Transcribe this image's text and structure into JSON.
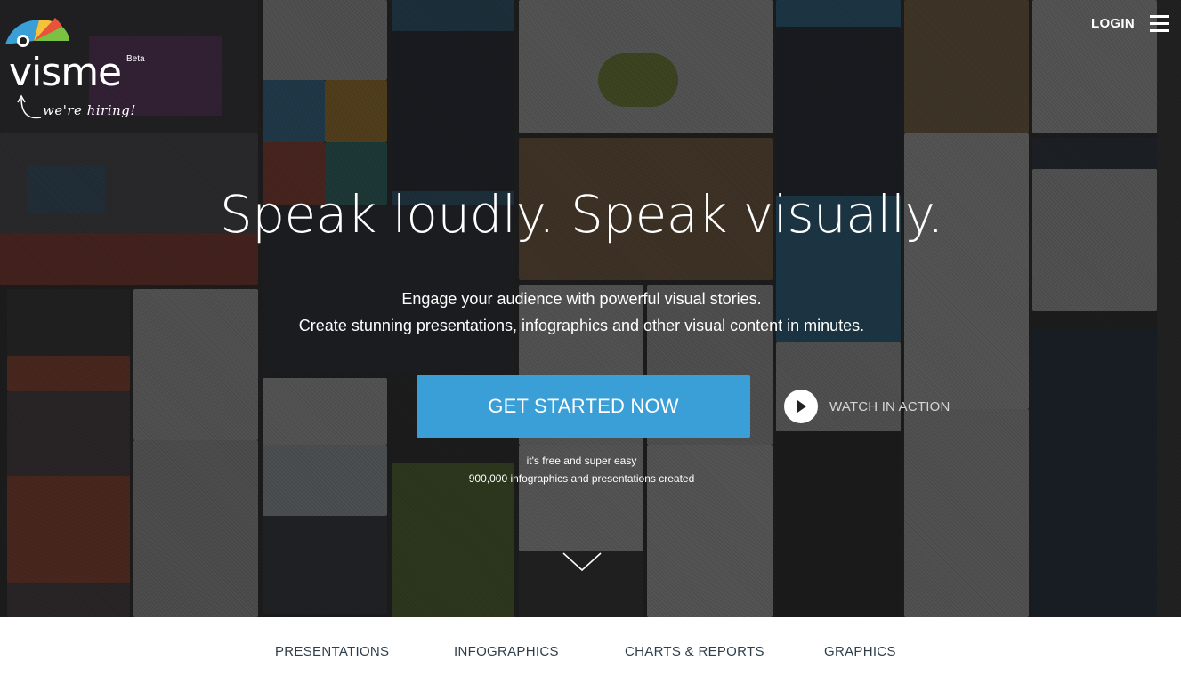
{
  "brand": {
    "name": "visme",
    "badge": "Beta",
    "tagline": "we're hiring!",
    "logo_colors": [
      "#3a9fd6",
      "#f5c33b",
      "#7bc143",
      "#e8533a",
      "#ffffff"
    ]
  },
  "nav": {
    "login_label": "LOGIN",
    "menu_icon": "hamburger-icon"
  },
  "hero": {
    "headline": "Speak loudly. Speak visually.",
    "subline_1": "Engage your audience with powerful visual stories.",
    "subline_2": "Create stunning presentations, infographics and other visual content in minutes.",
    "cta_label": "GET STARTED NOW",
    "cta_color": "#3a9fd6",
    "watch_label": "WATCH IN ACTION",
    "watch_icon": "play-icon",
    "note_1": "it's free and super easy",
    "note_2": "900,000 infographics and presentations created",
    "scroll_icon": "chevron-down-icon"
  },
  "tabs": [
    {
      "label": "PRESENTATIONS"
    },
    {
      "label": "INFOGRAPHICS"
    },
    {
      "label": "CHARTS & REPORTS"
    },
    {
      "label": "GRAPHICS"
    }
  ]
}
